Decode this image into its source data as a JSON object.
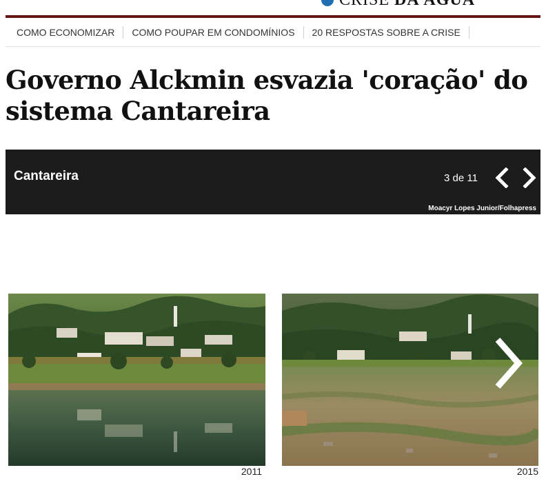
{
  "brand": {
    "prefix": "CRISE",
    "suffix": "DA ÁGUA"
  },
  "nav": {
    "items": [
      {
        "label": "COMO ECONOMIZAR"
      },
      {
        "label": "COMO POUPAR EM CONDOMÍNIOS"
      },
      {
        "label": "20 RESPOSTAS SOBRE A CRISE"
      }
    ]
  },
  "article": {
    "headline": "Governo Alckmin esvazia 'coração' do sistema Cantareira"
  },
  "gallery": {
    "title": "Cantareira",
    "counter": "3 de 11",
    "credit": "Moacyr Lopes Junior/Folhapress",
    "photos": [
      {
        "caption": "2011"
      },
      {
        "caption": "2015"
      }
    ]
  },
  "colors": {
    "rule": "#6b1414",
    "bar": "#1c1c1c",
    "brand_icon": "#1f6fb2"
  }
}
